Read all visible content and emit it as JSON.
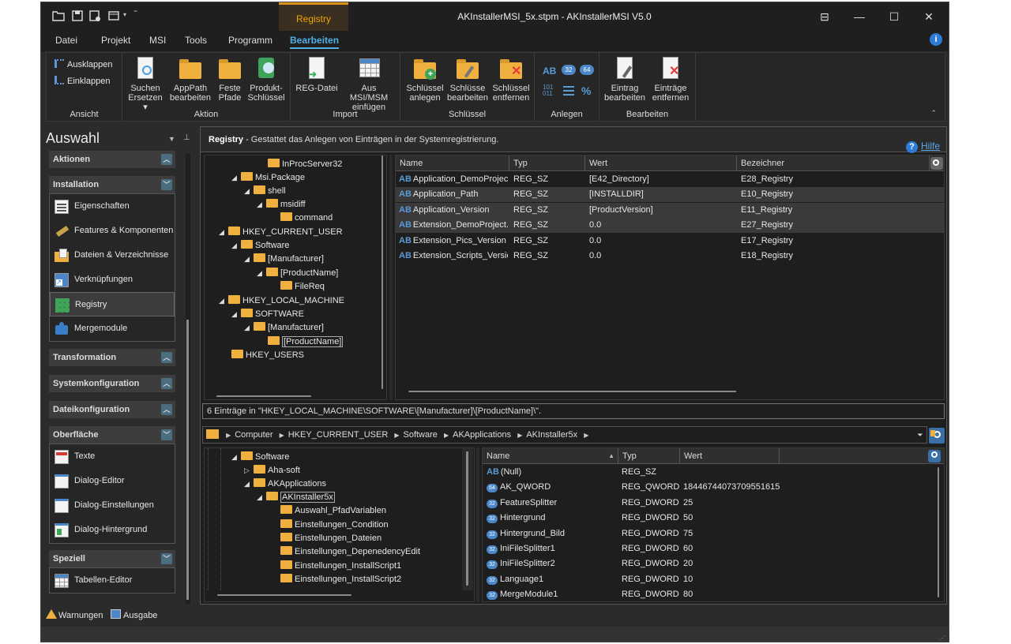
{
  "window": {
    "title": "AKInstallerMSI_5x.stpm - AKInstallerMSI V5.0",
    "context_tab": "Registry"
  },
  "menu": [
    "Datei",
    "Projekt",
    "MSI",
    "Tools",
    "Programm",
    "Bearbeiten"
  ],
  "ribbon": {
    "ansicht": {
      "label": "Ansicht",
      "expand": "Ausklappen",
      "collapse": "Einklappen"
    },
    "aktion": {
      "label": "Aktion",
      "b1": "Suchen",
      "b1b": "Ersetzen",
      "b2": "AppPath",
      "b2b": "bearbeiten",
      "b3": "Feste",
      "b3b": "Pfade",
      "b4": "Produkt-",
      "b4b": "Schlüssel"
    },
    "import": {
      "label": "Import",
      "b1": "REG-Datei",
      "b2": "Aus MSI/MSM",
      "b2b": "einfügen"
    },
    "schluessel": {
      "label": "Schlüssel",
      "b1": "Schlüssel",
      "b1b": "anlegen",
      "b2": "Schlüsse",
      "b2b": "bearbeiten",
      "b3": "Schlüssel",
      "b3b": "entfernen"
    },
    "anlegen": {
      "label": "Anlegen",
      "i1": "AB",
      "i2": "32",
      "i3": "64",
      "i4": "101",
      "i4b": "011",
      "i6": "%"
    },
    "bearbeiten": {
      "label": "Bearbeiten",
      "b1": "Eintrag",
      "b1b": "bearbeiten",
      "b2": "Einträge",
      "b2b": "entfernen"
    }
  },
  "sidebar": {
    "title": "Auswahl",
    "sections": {
      "aktionen": "Aktionen",
      "installation": "Installation",
      "transformation": "Transformation",
      "systemkonfiguration": "Systemkonfiguration",
      "dateikonfiguration": "Dateikonfiguration",
      "oberflaeche": "Oberfläche",
      "speziell": "Speziell"
    },
    "installation_items": [
      "Eigenschaften",
      "Features & Komponenten",
      "Dateien & Verzeichnisse",
      "Verknüpfungen",
      "Registry",
      "Mergemodule"
    ],
    "oberflaeche_items": [
      "Texte",
      "Dialog-Editor",
      "Dialog-Einstellungen",
      "Dialog-Hintergrund"
    ],
    "speziell_items": [
      "Tabellen-Editor"
    ]
  },
  "main": {
    "header_bold": "Registry",
    "header_text": " - Gestattet das Anlegen von Einträgen in der Systemregistrierung.",
    "help": "Hilfe",
    "tree": [
      "InProcServer32",
      "Msi.Package",
      "shell",
      "msidiff",
      "command",
      "HKEY_CURRENT_USER",
      "Software",
      "[Manufacturer]",
      "[ProductName]",
      "FileReq",
      "HKEY_LOCAL_MACHINE",
      "SOFTWARE",
      "[Manufacturer]",
      "[ProductName]",
      "HKEY_USERS"
    ],
    "grid_headers": [
      "Name",
      "Typ",
      "Wert",
      "Bezeichner"
    ],
    "rows": [
      [
        "Application_DemoProjec...",
        "REG_SZ",
        "[E42_Directory]",
        "E28_Registry"
      ],
      [
        "Application_Path",
        "REG_SZ",
        "[INSTALLDIR]",
        "E10_Registry"
      ],
      [
        "Application_Version",
        "REG_SZ",
        "[ProductVersion]",
        "E11_Registry"
      ],
      [
        "Extension_DemoProject...",
        "REG_SZ",
        "0.0",
        "E27_Registry"
      ],
      [
        "Extension_Pics_Version",
        "REG_SZ",
        "0.0",
        "E17_Registry"
      ],
      [
        "Extension_Scripts_Version",
        "REG_SZ",
        "0.0",
        "E18_Registry"
      ]
    ],
    "status": "6 Einträge in \"HKEY_LOCAL_MACHINE\\SOFTWARE\\[Manufacturer]\\[ProductName]\\\"."
  },
  "lower": {
    "path": [
      "Computer",
      "HKEY_CURRENT_USER",
      "Software",
      "AKApplications",
      "AKInstaller5x"
    ],
    "tree": [
      "Software",
      "Aha-soft",
      "AKApplications",
      "AKInstaller5x",
      "Auswahl_PfadVariablen",
      "Einstellungen_Condition",
      "Einstellungen_Dateien",
      "Einstellungen_DepenedencyEdit",
      "Einstellungen_InstallScript1",
      "Einstellungen_InstallScript2"
    ],
    "grid_headers": [
      "Name",
      "Typ",
      "Wert"
    ],
    "rows": [
      [
        "AB",
        "(Null)",
        "REG_SZ",
        ""
      ],
      [
        "64",
        "AK_QWORD",
        "REG_QWORD",
        "18446744073709551615"
      ],
      [
        "32",
        "FeatureSplitter",
        "REG_DWORD",
        "25"
      ],
      [
        "32",
        "Hintergrund",
        "REG_DWORD",
        "50"
      ],
      [
        "32",
        "Hintergrund_Bild",
        "REG_DWORD",
        "75"
      ],
      [
        "32",
        "IniFileSplitter1",
        "REG_DWORD",
        "60"
      ],
      [
        "32",
        "IniFileSplitter2",
        "REG_DWORD",
        "20"
      ],
      [
        "32",
        "Language1",
        "REG_DWORD",
        "10"
      ],
      [
        "32",
        "MergeModule1",
        "REG_DWORD",
        "80"
      ]
    ]
  },
  "bottom": {
    "warnings": "Warnungen",
    "output": "Ausgabe"
  }
}
